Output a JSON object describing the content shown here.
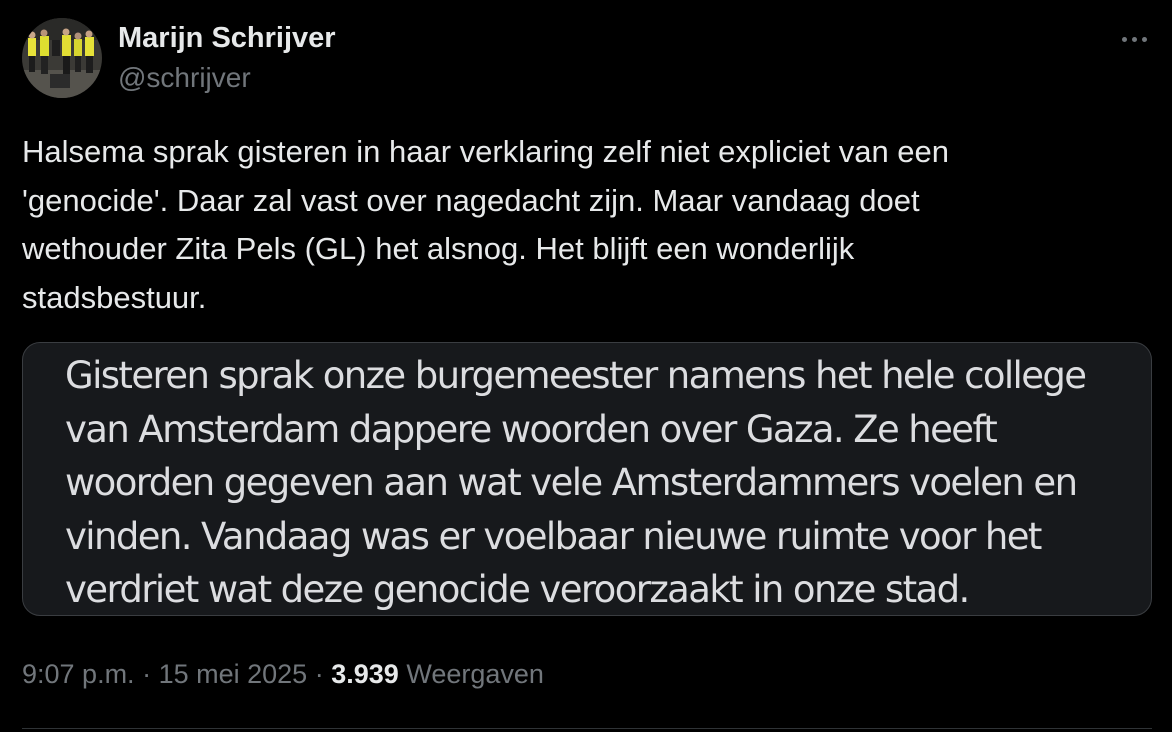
{
  "author": {
    "display_name": "Marijn Schrijver",
    "handle": "@schrijver"
  },
  "menu": {
    "more_icon": "more-horizontal-icon"
  },
  "tweet": {
    "text_lines": [
      "Halsema sprak gisteren in haar verklaring zelf niet expliciet van een",
      "'genocide'. Daar zal vast over nagedacht zijn. Maar vandaag doet",
      "wethouder Zita Pels (GL) het alsnog. Het blijft een wonderlijk",
      "stadsbestuur."
    ]
  },
  "quoted_image": {
    "text_lines": [
      "Gisteren sprak onze burgemeester namens het hele college",
      "van Amsterdam dappere woorden over Gaza. Ze heeft",
      "woorden gegeven aan wat vele Amsterdammers voelen en",
      "vinden. Vandaag was er voelbaar nieuwe ruimte voor het",
      "verdriet wat deze genocide veroorzaakt in onze stad."
    ]
  },
  "meta": {
    "time": "9:07 p.m.",
    "separator": "·",
    "date": "15 mei 2025",
    "views_count": "3.939",
    "views_label": "Weergaven"
  },
  "colors": {
    "background": "#000000",
    "primary_text": "#e7e9ea",
    "secondary_text": "#71767b",
    "card_border": "#3a3d41",
    "card_background": "#17191c"
  }
}
